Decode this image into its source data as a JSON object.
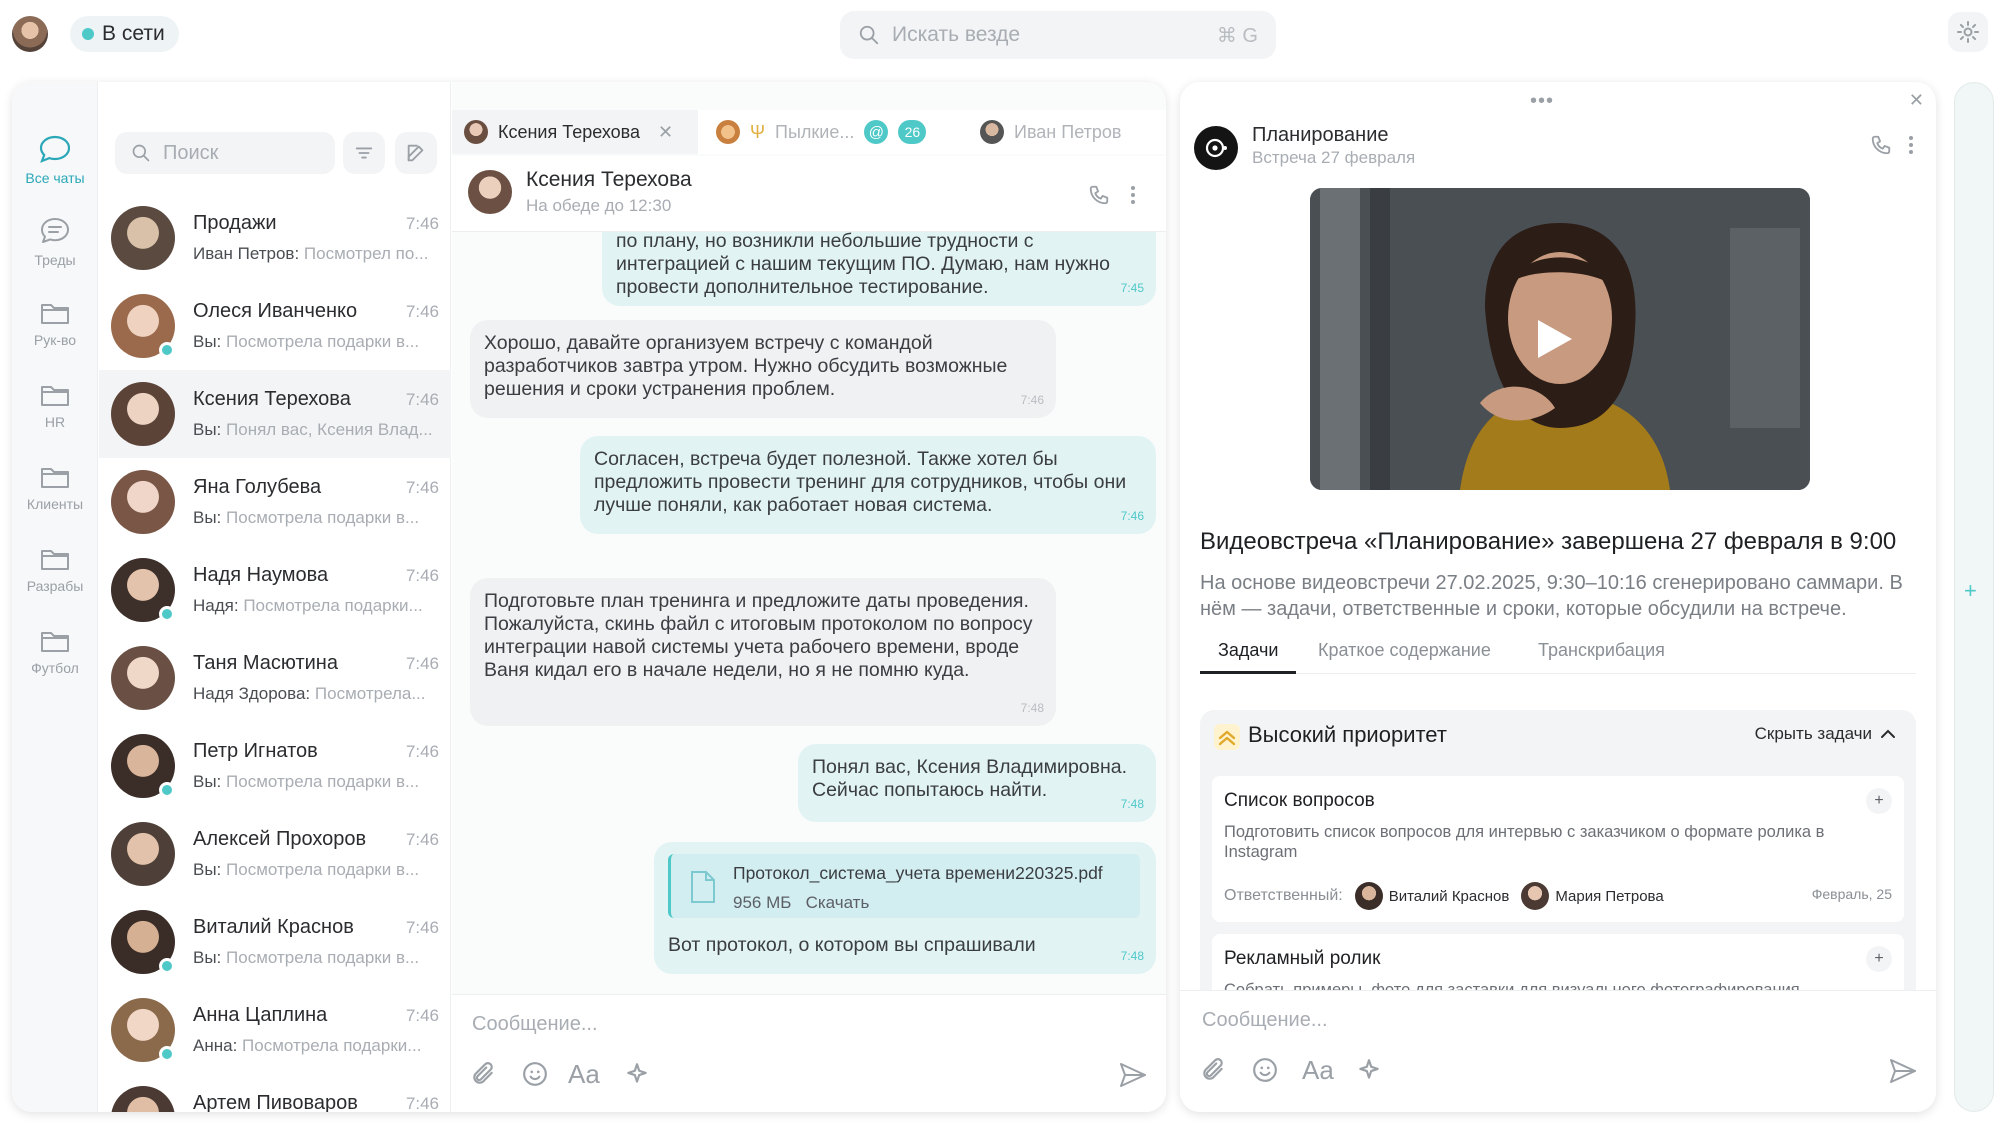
{
  "top": {
    "status": "В сети",
    "search_placeholder": "Искать везде",
    "search_shortcut": "⌘ G"
  },
  "rail": {
    "items": [
      {
        "label": "Все чаты",
        "icon": "chat-bubble-icon",
        "active": true
      },
      {
        "label": "Треды",
        "icon": "threads-icon"
      },
      {
        "label": "Рук-во",
        "icon": "folder-icon"
      },
      {
        "label": "HR",
        "icon": "folder-icon"
      },
      {
        "label": "Клиенты",
        "icon": "folder-icon"
      },
      {
        "label": "Разрабы",
        "icon": "folder-icon"
      },
      {
        "label": "Футбол",
        "icon": "folder-icon"
      }
    ]
  },
  "chatlist": {
    "search_placeholder": "Поиск",
    "items": [
      {
        "name": "Продажи",
        "time": "7:46",
        "sender": "Иван Петров:",
        "preview": "Посмотрел по...",
        "online": false
      },
      {
        "name": "Олеся Иванченко",
        "time": "7:46",
        "sender": "Вы:",
        "preview": "Посмотрела подарки в...",
        "online": true
      },
      {
        "name": "Ксения Терехова",
        "time": "7:46",
        "sender": "Вы:",
        "preview": "Понял вас, Ксения Влад...",
        "online": false,
        "active": true
      },
      {
        "name": "Яна Голубева",
        "time": "7:46",
        "sender": "Вы:",
        "preview": "Посмотрела подарки в...",
        "online": false
      },
      {
        "name": "Надя Наумова",
        "time": "7:46",
        "sender": "Надя:",
        "preview": "Посмотрела подарки...",
        "online": true
      },
      {
        "name": "Таня Масютина",
        "time": "7:46",
        "sender": "Надя Здорова:",
        "preview": "Посмотрела...",
        "online": false
      },
      {
        "name": "Петр Игнатов",
        "time": "7:46",
        "sender": "Вы:",
        "preview": "Посмотрела подарки в...",
        "online": true
      },
      {
        "name": "Алексей Прохоров",
        "time": "7:46",
        "sender": "Вы:",
        "preview": "Посмотрела подарки в...",
        "online": false
      },
      {
        "name": "Виталий Краснов",
        "time": "7:46",
        "sender": "Вы:",
        "preview": "Посмотрела подарки в...",
        "online": true
      },
      {
        "name": "Анна Цаплина",
        "time": "7:46",
        "sender": "Анна:",
        "preview": "Посмотрела подарки...",
        "online": true
      },
      {
        "name": "Артем Пивоваров",
        "time": "7:46",
        "sender": "",
        "preview": "",
        "online": false
      }
    ]
  },
  "tabs": {
    "active": "Ксения Терехова",
    "second": "Пылкие...",
    "second_badge": "26",
    "mention": "@",
    "third": "Иван Петров"
  },
  "conversation": {
    "name": "Ксения Терехова",
    "status": "На обеде до 12:30",
    "messages": [
      {
        "dir": "out",
        "text": "по плану, но возникли небольшие трудности с интеграцией с нашим текущим ПО. Думаю, нам нужно провести дополнительное тестирование.",
        "time": "7:45"
      },
      {
        "dir": "in",
        "text": "Хорошо, давайте организуем встречу с командой разработчиков завтра утром. Нужно обсудить возможные решения и сроки устранения проблем.",
        "time": "7:46"
      },
      {
        "dir": "out",
        "text": "Согласен, встреча будет полезной. Также хотел бы предложить провести тренинг для сотрудников, чтобы они лучше поняли, как работает новая система.",
        "time": "7:46"
      },
      {
        "dir": "in",
        "text": "Подготовьте план тренинга и предложите даты проведения. Пожалуйста, скинь файл с итоговым протоколом по вопросу интеграции навой системы учета рабочего времени, вроде Ваня кидал его в начале недели, но я не помню куда.",
        "time": "7:48"
      },
      {
        "dir": "out",
        "text": "Понял вас, Ксения Владимировна. Сейчас попытаюсь найти.",
        "time": "7:48"
      },
      {
        "dir": "out",
        "text": "Вот протокол, о котором вы спрашивали",
        "time": "7:48"
      }
    ],
    "file": {
      "name": "Протокол_система_учета времени220325.pdf",
      "size": "956 МБ",
      "action": "Скачать"
    },
    "composer_placeholder": "Сообщение...",
    "format_label": "Aa"
  },
  "meeting": {
    "title": "Планирование",
    "date": "Встреча 27 февраля",
    "summary_title": "Видеовстреча «Планирование» завершена 27 февраля в  9:00",
    "summary_text": "На основе видеовстречи 27.02.2025, 9:30–10:16 сгенерировано саммари. В нём — задачи, ответственные и сроки, которые обсудили на встрече.",
    "tabs": [
      "Задачи",
      "Краткое содержание",
      "Транскрибация"
    ],
    "priority_title": "Высокий приоритет",
    "hide_label": "Скрыть задачи",
    "tasks": [
      {
        "title": "Список вопросов",
        "desc": "Подготовить список вопросов для интервью с заказчиком о формате ролика в Instagram",
        "assignee_label": "Ответственный:",
        "assignees": [
          "Виталий Краснов",
          "Мария Петрова"
        ],
        "date": "Февраль, 25"
      },
      {
        "title": "Рекламный ролик",
        "desc": "Собрать примеры, фото для заставки для визуального фотографирования"
      }
    ],
    "composer_placeholder": "Сообщение...",
    "format_label": "Aa"
  },
  "colors": {
    "accent": "#4fc8c8",
    "bubble_out": "#e2f3f4",
    "bubble_in": "#f0f1f2",
    "active_item": "#f3f4f6"
  }
}
